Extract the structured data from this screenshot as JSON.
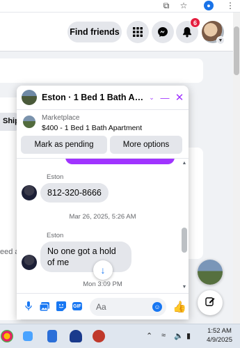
{
  "header": {
    "find_friends_label": "Find friends",
    "notification_count": "6"
  },
  "background": {
    "chip_label": "Ship",
    "partial_text": "eed a"
  },
  "chat": {
    "title": "Eston · 1 Bed 1 Bath Apart...",
    "marketplace_label": "Marketplace",
    "listing": "$400 - 1 Bed 1 Bath Apartment",
    "mark_pending_label": "Mark as pending",
    "more_options_label": "More options",
    "messages": [
      {
        "sender": "Eston",
        "text": "812-320-8666"
      },
      {
        "timestamp": "Mar 26, 2025, 5:26 AM"
      },
      {
        "sender": "Eston",
        "text": "No one got a hold of me"
      },
      {
        "timestamp": "Mon 3:09 PM"
      }
    ],
    "composer_placeholder": "Aa"
  },
  "taskbar": {
    "time": "1:52 AM",
    "date": "4/9/2025"
  },
  "colors": {
    "accent": "#a033ff",
    "brand": "#1877f2",
    "badge": "#e41e3f"
  }
}
